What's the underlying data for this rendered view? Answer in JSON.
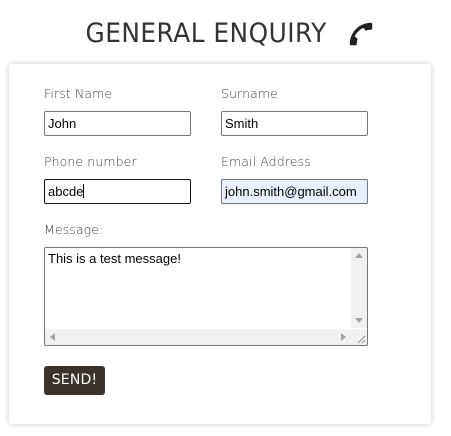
{
  "header": {
    "title": "GENERAL ENQUIRY",
    "icon": "phone-icon"
  },
  "form": {
    "first_name": {
      "label": "First Name",
      "value": "John"
    },
    "surname": {
      "label": "Surname",
      "value": "Smith"
    },
    "phone": {
      "label": "Phone number",
      "value": "abcde"
    },
    "email": {
      "label": "Email Address",
      "value": "john.smith@gmail.com"
    },
    "message": {
      "label": "Message:",
      "value": "This is a test message!"
    },
    "submit_label": "SEND!"
  },
  "colors": {
    "button_bg": "#3a322b",
    "autofill_bg": "#e8f0fe",
    "text": "#333333"
  }
}
